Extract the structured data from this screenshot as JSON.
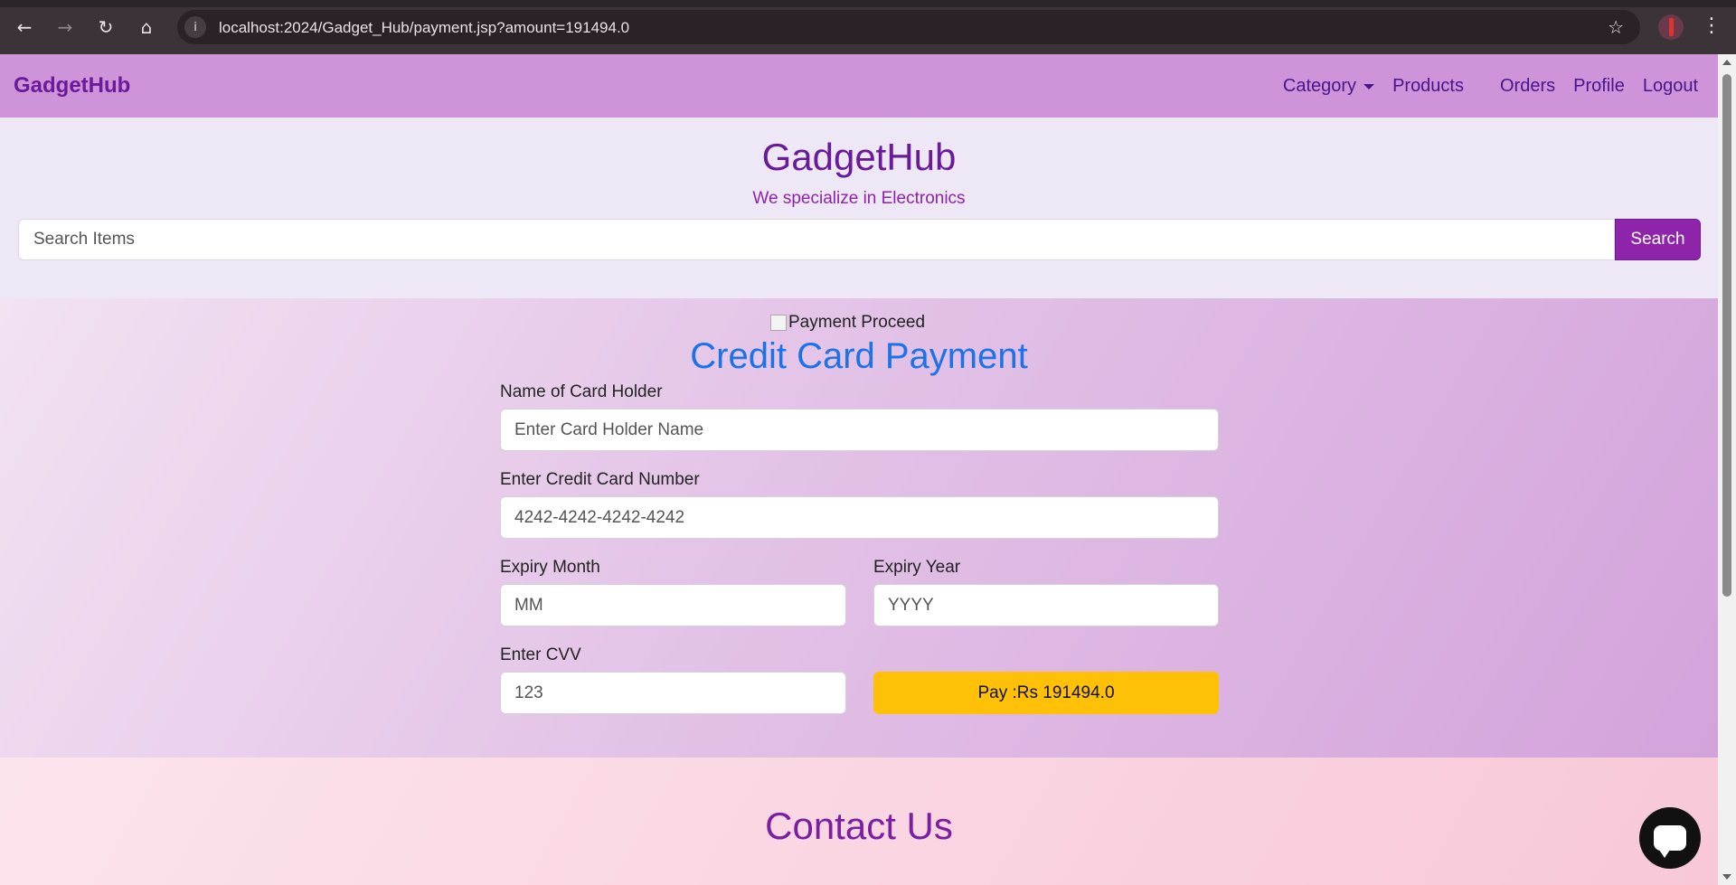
{
  "browser": {
    "url": "localhost:2024/Gadget_Hub/payment.jsp?amount=191494.0",
    "back_icon": "←",
    "forward_icon": "→",
    "reload_icon": "↻",
    "home_icon": "⌂",
    "info_icon": "i",
    "star_icon": "☆",
    "menu_icon": "⋮"
  },
  "navbar": {
    "brand": "GadgetHub",
    "links": {
      "category": "Category",
      "products": "Products",
      "orders": "Orders",
      "profile": "Profile",
      "logout": "Logout"
    }
  },
  "hero": {
    "title": "GadgetHub",
    "subtitle": "We specialize in Electronics",
    "search_placeholder": "Search Items",
    "search_button": "Search"
  },
  "payment": {
    "image_alt": "Payment Proceed",
    "title": "Credit Card Payment",
    "card_holder_label": "Name of Card Holder",
    "card_holder_placeholder": "Enter Card Holder Name",
    "card_number_label": "Enter Credit Card Number",
    "card_number_placeholder": "4242-4242-4242-4242",
    "expiry_month_label": "Expiry Month",
    "expiry_month_placeholder": "MM",
    "expiry_year_label": "Expiry Year",
    "expiry_year_placeholder": "YYYY",
    "cvv_label": "Enter CVV",
    "cvv_placeholder": "123",
    "pay_button": "Pay :Rs 191494.0"
  },
  "contact": {
    "title": "Contact Us"
  },
  "colors": {
    "navbar_bg": "#ce93d8",
    "brand_purple": "#6a1b9a",
    "title_blue": "#1a73e8",
    "pay_button": "#ffc107"
  }
}
